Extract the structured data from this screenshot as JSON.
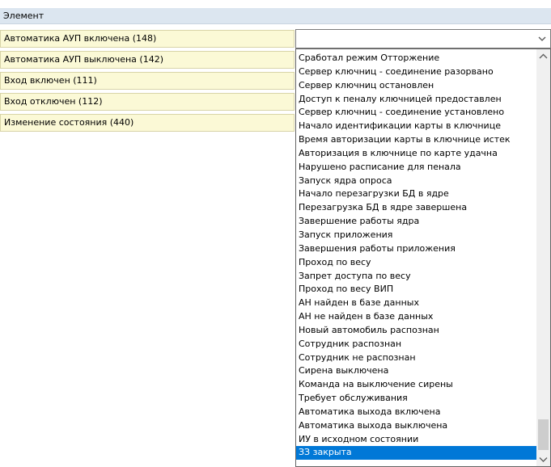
{
  "header": {
    "title": "Элемент"
  },
  "left_rows": [
    "Автоматика АУП включена (148)",
    "Автоматика АУП выключена (142)",
    "Вход включен (111)",
    "Вход отключен (112)",
    "Изменение состояния (440)"
  ],
  "combo": {
    "value": "",
    "arrow_icon": "chevron-down-icon"
  },
  "dropdown": {
    "items": [
      "Сработал режим Отторжение",
      "Сервер ключниц - соединение разорвано",
      "Сервер ключниц остановлен",
      "Доступ к пеналу ключницей предоставлен",
      "Сервер ключниц - соединение установлено",
      "Начало идентификации карты в ключнице",
      "Время авторизации карты в ключнице истек",
      "Авторизация в ключнице по карте удачна",
      "Нарушено расписание для пенала",
      "Запуск ядра опроса",
      "Начало перезагрузки БД в ядре",
      "Перезагрузка БД в ядре завершена",
      "Завершение работы ядра",
      "Запуск приложения",
      "Завершения работы приложения",
      "Проход по весу",
      "Запрет доступа по весу",
      "Проход по весу ВИП",
      "АН найден в базе данных",
      "АН не найден в базе данных",
      "Новый автомобиль распознан",
      "Сотрудник распознан",
      "Сотрудник не распознан",
      "Сирена выключена",
      "Команда на выключение сирены",
      "Требует обслуживания",
      "Автоматика выхода включена",
      "Автоматика выхода выключена",
      "ИУ в исходном состоянии",
      "ЗЗ закрыта"
    ],
    "selected_index": 29
  }
}
